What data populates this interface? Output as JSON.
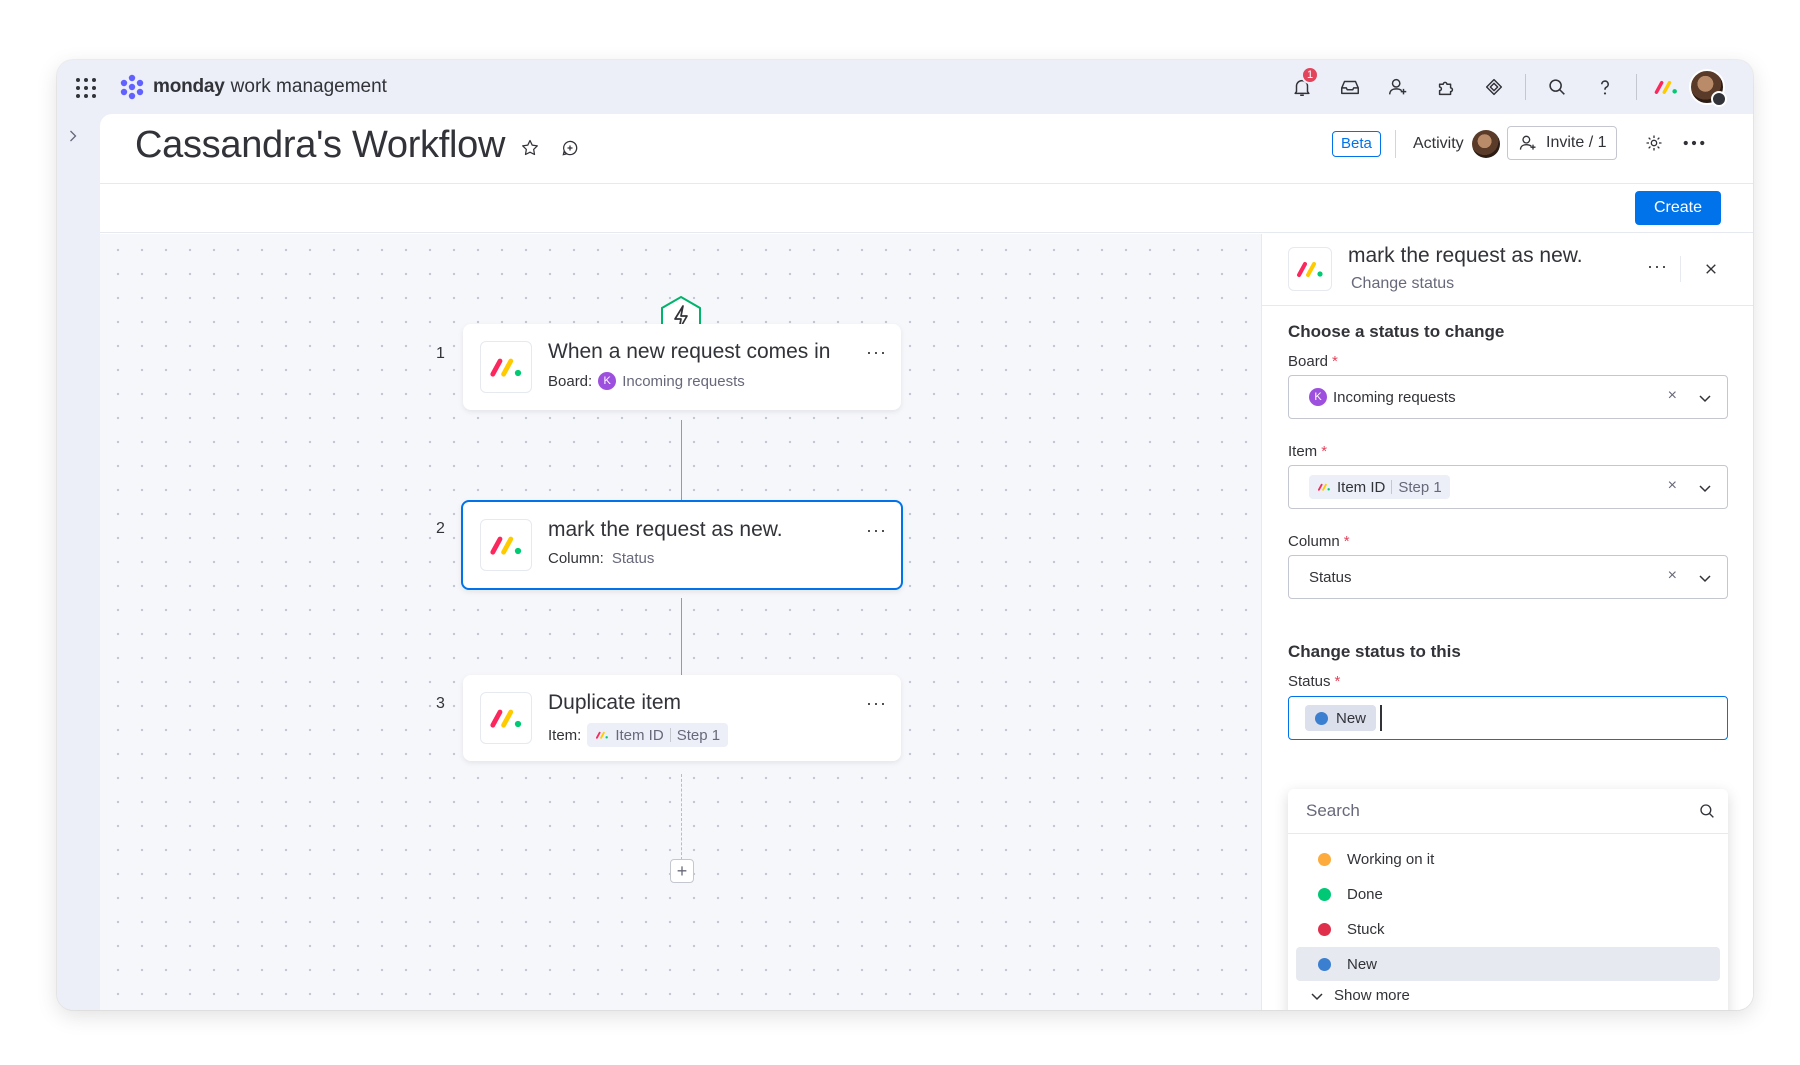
{
  "app": {
    "brand_name": "monday",
    "brand_sub": "work management",
    "notification_count": "1"
  },
  "header": {
    "title": "Cassandra's Workflow",
    "beta_label": "Beta",
    "activity_label": "Activity",
    "invite_label": "Invite / 1",
    "create_label": "Create"
  },
  "steps": [
    {
      "number": "1",
      "title": "When a new request comes in",
      "sub_label": "Board:",
      "board_initial": "K",
      "board_name": "Incoming requests"
    },
    {
      "number": "2",
      "title": "mark the request as new.",
      "sub_label": "Column:",
      "column_value": "Status"
    },
    {
      "number": "3",
      "title": "Duplicate item",
      "sub_label": "Item:",
      "chip_main": "Item ID",
      "chip_step": "Step 1"
    }
  ],
  "panel": {
    "title": "mark the request as new.",
    "subtitle": "Change status",
    "section1_title": "Choose a status to change",
    "board_label": "Board",
    "board_initial": "K",
    "board_value": "Incoming requests",
    "item_label": "Item",
    "item_chip_main": "Item ID",
    "item_chip_step": "Step 1",
    "column_label": "Column",
    "column_value": "Status",
    "section2_title": "Change status to this",
    "status_label": "Status",
    "status_selected": "New",
    "status_selected_color": "#3b7fd1",
    "required_mark": "*",
    "clear_glyph": "×"
  },
  "dropdown": {
    "search_placeholder": "Search",
    "options": [
      {
        "label": "Working on it",
        "color": "#fdab3d"
      },
      {
        "label": "Done",
        "color": "#00c875"
      },
      {
        "label": "Stuck",
        "color": "#df2f4a"
      },
      {
        "label": "New",
        "color": "#3b7fd1"
      }
    ],
    "show_more": "Show more"
  },
  "colors": {
    "accent": "#0073ea",
    "notification_red": "#e2445c",
    "board_purple": "#9d50dd"
  }
}
